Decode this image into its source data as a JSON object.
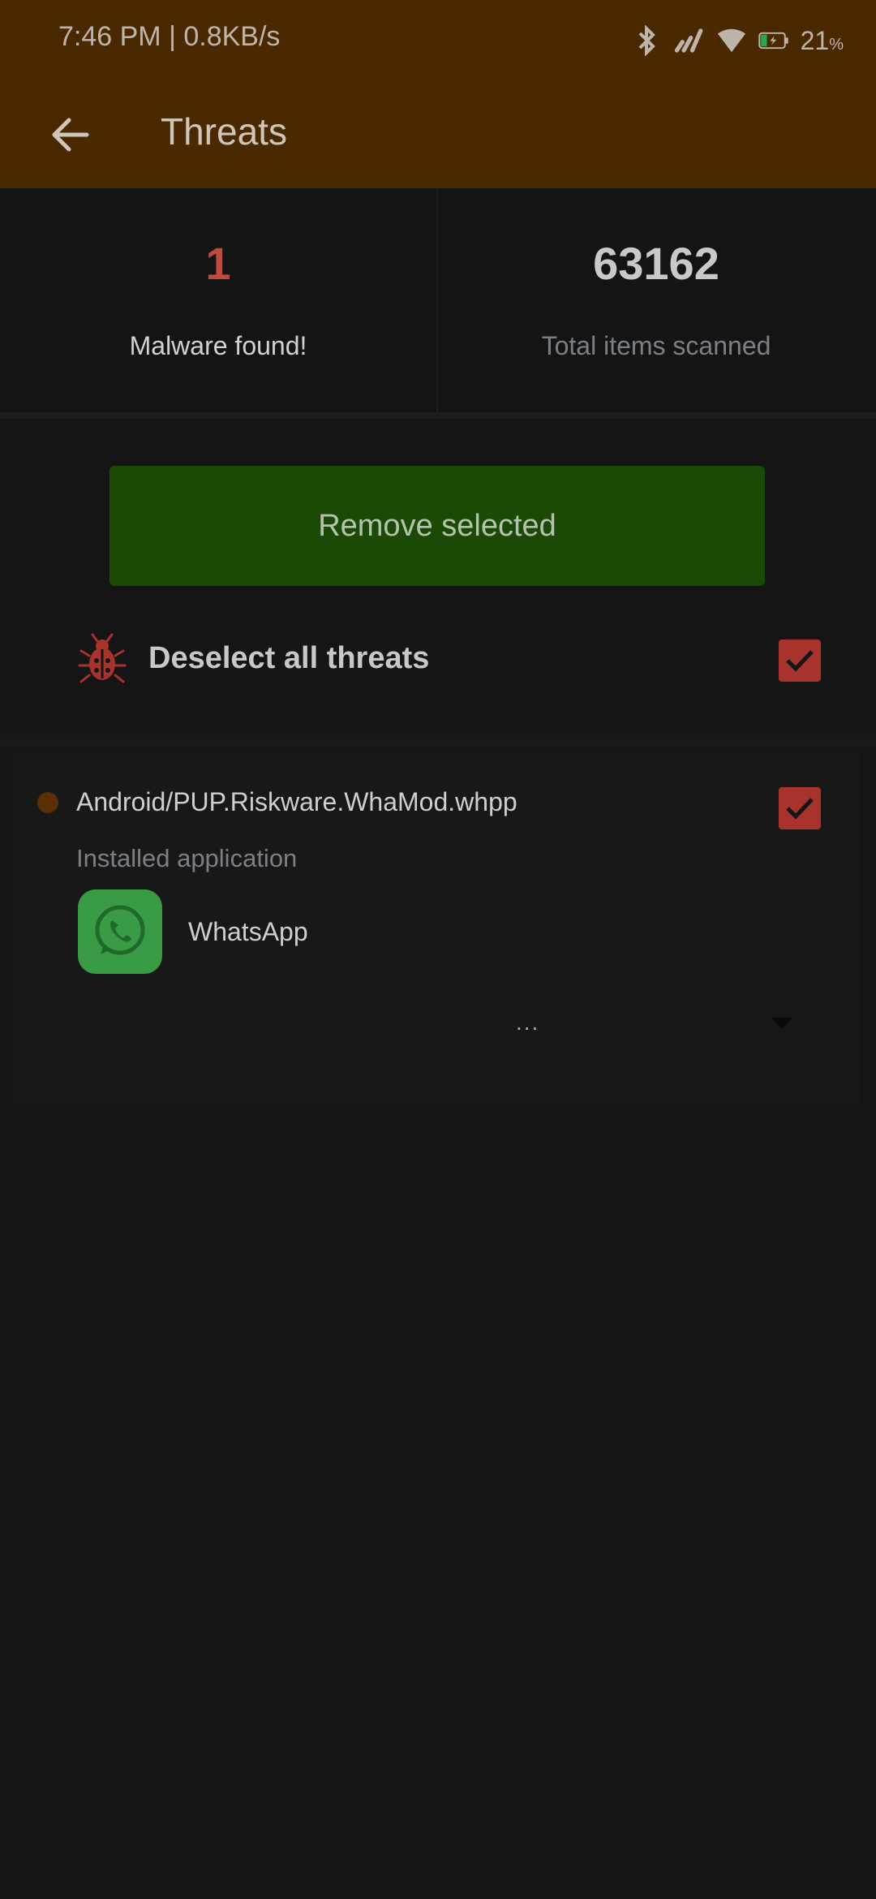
{
  "status_bar": {
    "time": "7:46 PM | 0.8KB/s",
    "battery": "21",
    "battery_unit": "%"
  },
  "app_bar": {
    "title": "Threats",
    "back_icon": "arrow-left-icon"
  },
  "stats": {
    "malware_count": "1",
    "malware_label": "Malware found!",
    "scanned_count": "63162",
    "scanned_label": "Total items scanned"
  },
  "actions": {
    "remove_label": "Remove selected"
  },
  "deselect": {
    "label": "Deselect all threats",
    "checked": true,
    "icon": "bug-icon"
  },
  "threats": [
    {
      "name": "Android/PUP.Riskware.WhaMod.whpp",
      "type": "Installed application",
      "app_name": "WhatsApp",
      "checked": true,
      "more": "..."
    }
  ],
  "colors": {
    "appbar": "#4a2900",
    "button": "#1a4a06",
    "checkbox": "#a8322c",
    "malware_count": "#c24a3a",
    "background": "#151515"
  }
}
